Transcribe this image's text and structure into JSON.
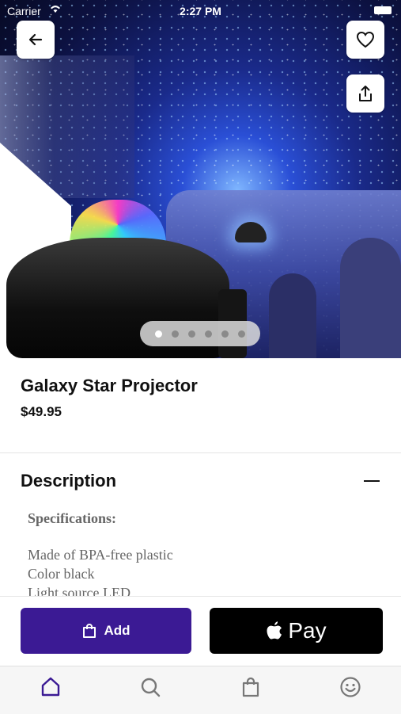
{
  "status_bar": {
    "carrier": "Carrier",
    "time": "2:27 PM"
  },
  "product": {
    "title": "Galaxy Star Projector",
    "price": "$49.95"
  },
  "carousel": {
    "count": 6,
    "active_index": 0
  },
  "description": {
    "heading": "Description",
    "specifications_label": "Specifications:",
    "lines": [
      "Made of BPA-free plastic",
      "Color black",
      "Light source LED"
    ]
  },
  "actions": {
    "add_label": "Add",
    "pay_label": "Pay"
  },
  "tabs": [
    {
      "name": "home",
      "icon": "home-icon",
      "active": true
    },
    {
      "name": "search",
      "icon": "search-icon",
      "active": false
    },
    {
      "name": "bag",
      "icon": "bag-icon",
      "active": false
    },
    {
      "name": "account",
      "icon": "smiley-icon",
      "active": false
    }
  ],
  "colors": {
    "accent": "#3b1a94",
    "pay_button": "#000000",
    "active_tab": "#3b1a94",
    "inactive_tab": "#777777"
  }
}
